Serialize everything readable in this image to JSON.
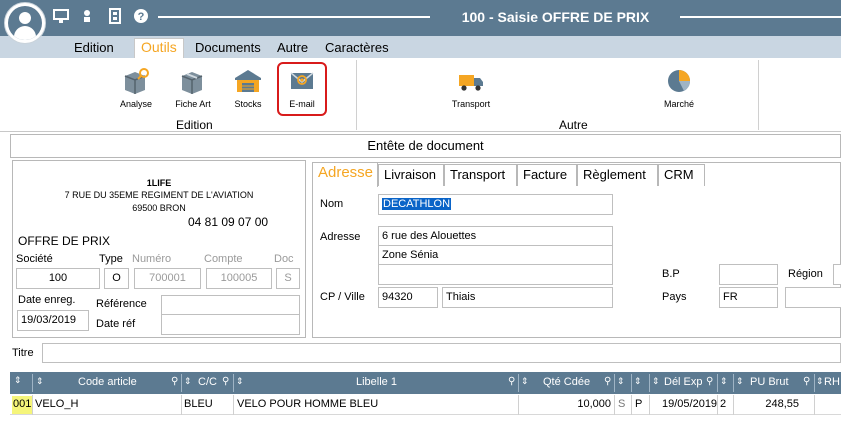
{
  "window": {
    "title": "100 - Saisie OFFRE DE PRIX",
    "toolbar_icons": [
      "monitor-icon",
      "user-pin-icon",
      "film-icon",
      "help-icon"
    ]
  },
  "menu": {
    "items": [
      "Edition",
      "Outils",
      "Documents",
      "Autre",
      "Caractères"
    ],
    "active": "Outils"
  },
  "ribbon": {
    "edition_group": "Edition",
    "autre_group": "Autre",
    "buttons": [
      {
        "label": "Analyse",
        "icon": "box-search-icon"
      },
      {
        "label": "Fiche Art",
        "icon": "box-icon"
      },
      {
        "label": "Stocks",
        "icon": "warehouse-icon"
      },
      {
        "label": "E-mail",
        "icon": "email-icon"
      },
      {
        "label": "Transport",
        "icon": "truck-icon"
      },
      {
        "label": "Marché",
        "icon": "pie-chart-icon"
      }
    ]
  },
  "header": {
    "title": "Entête de document"
  },
  "company": {
    "name": "1LIFE",
    "address": "7 RUE DU 35EME REGIMENT DE L'AVIATION",
    "city": "69500 BRON",
    "phone": "04 81 09 07 00",
    "doc_type": "OFFRE DE PRIX",
    "labels": {
      "societe": "Société",
      "type": "Type",
      "numero": "Numéro",
      "compte": "Compte",
      "doc": "Doc",
      "date_enreg": "Date enreg.",
      "reference": "Référence",
      "date_ref": "Date réf"
    },
    "values": {
      "societe": "100",
      "type": "O",
      "numero": "700001",
      "compte": "100005",
      "doc": "S",
      "date_enreg": "19/03/2019",
      "reference": "",
      "date_ref": ""
    }
  },
  "address_tabs": [
    "Adresse",
    "Livraison",
    "Transport",
    "Facture",
    "Règlement",
    "CRM"
  ],
  "address": {
    "labels": {
      "nom": "Nom",
      "adresse": "Adresse",
      "cp_ville": "CP / Ville",
      "bp": "B.P",
      "pays": "Pays",
      "region": "Région"
    },
    "nom": "DECATHLON",
    "adresse1": "6 rue des Alouettes",
    "adresse2": "Zone Sénia",
    "adresse3": "",
    "cp": "94320",
    "ville": "Thiais",
    "bp": "",
    "pays": "FR",
    "region": ""
  },
  "titre": {
    "label": "Titre",
    "value": ""
  },
  "grid": {
    "columns": [
      "Code article",
      "C/C",
      "Libelle 1",
      "Qté Cdée",
      "Dél Exp",
      "PU Brut",
      "RH"
    ],
    "rows": [
      {
        "line": "001",
        "code": "VELO_H",
        "cc": "BLEU",
        "libelle": "VELO POUR HOMME BLEU",
        "qte": "10,000",
        "s": "S",
        "p": "P",
        "del_exp": "19/05/2019",
        "n": "2",
        "pu_brut": "248,55"
      }
    ]
  },
  "colors": {
    "titlebar": "#5c7a91",
    "menubar": "#c9d6e2",
    "accent": "#f5a623",
    "highlight": "#d81b1b",
    "selection": "#0a64c8",
    "row_marker": "#f5f57a"
  }
}
